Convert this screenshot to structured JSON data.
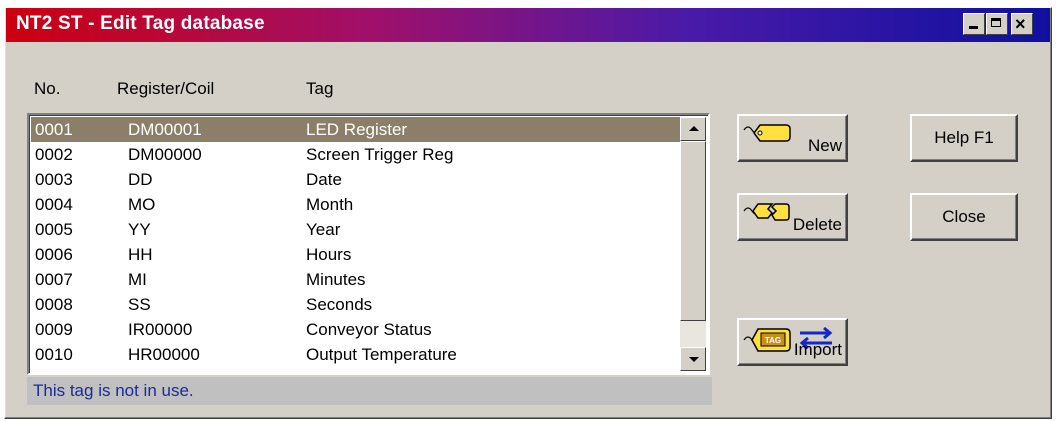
{
  "window": {
    "title": "NT2 ST - Edit Tag database",
    "buttons": [
      "minimize-icon",
      "maximize-icon",
      "close-icon"
    ],
    "close_glyph": "×"
  },
  "columns": {
    "no": "No.",
    "register": "Register/Coil",
    "tag": "Tag"
  },
  "rows": [
    {
      "no": "0001",
      "register": "DM00001",
      "tag": "LED Register",
      "selected": true
    },
    {
      "no": "0002",
      "register": "DM00000",
      "tag": "Screen Trigger Reg"
    },
    {
      "no": "0003",
      "register": "DD",
      "tag": "Date"
    },
    {
      "no": "0004",
      "register": "MO",
      "tag": "Month"
    },
    {
      "no": "0005",
      "register": "YY",
      "tag": "Year"
    },
    {
      "no": "0006",
      "register": "HH",
      "tag": "Hours"
    },
    {
      "no": "0007",
      "register": "MI",
      "tag": "Minutes"
    },
    {
      "no": "0008",
      "register": "SS",
      "tag": "Seconds"
    },
    {
      "no": "0009",
      "register": "IR00000",
      "tag": "Conveyor Status"
    },
    {
      "no": "0010",
      "register": "HR00000",
      "tag": "Output Temperature"
    }
  ],
  "status": "This tag is not in use.",
  "buttons": {
    "new": "New",
    "delete": "Delete",
    "import": "Import",
    "help": "Help  F1",
    "close": "Close",
    "import_tag_text": "TAG"
  },
  "colors": {
    "title_start": "#cc0010",
    "title_end": "#1010a0",
    "selection": "#8b7f69",
    "status_text": "#1a2a9a",
    "tag_yellow": "#ffe040"
  }
}
